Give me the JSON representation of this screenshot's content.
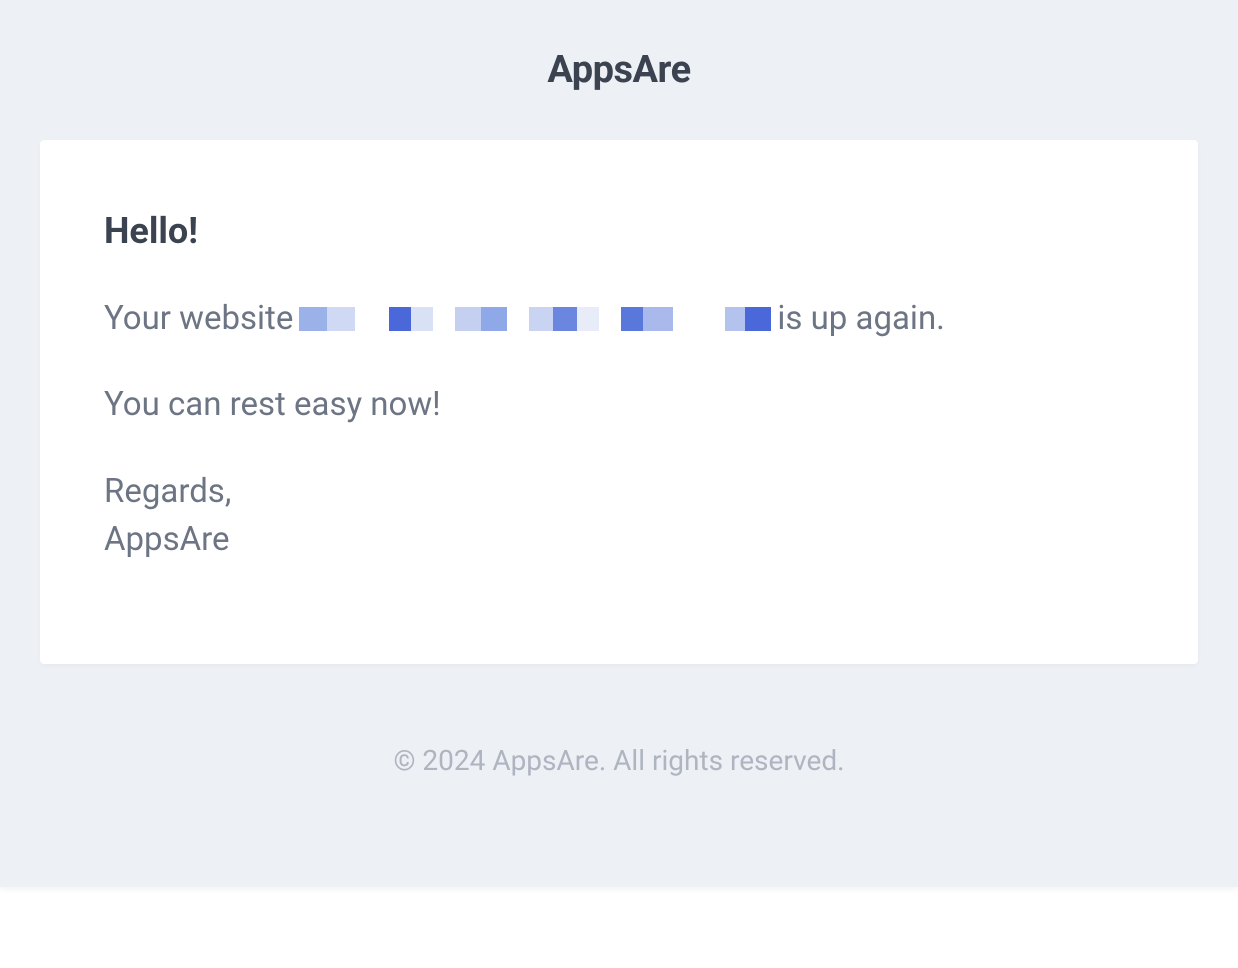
{
  "header": {
    "brand": "AppsAre"
  },
  "card": {
    "greeting": "Hello!",
    "line1_prefix": "Your website",
    "line1_suffix": "is up again.",
    "line2": "You can rest easy now!",
    "signature_line1": "Regards,",
    "signature_line2": "AppsAre"
  },
  "footer": {
    "copyright": "© 2024 AppsAre. All rights reserved."
  }
}
